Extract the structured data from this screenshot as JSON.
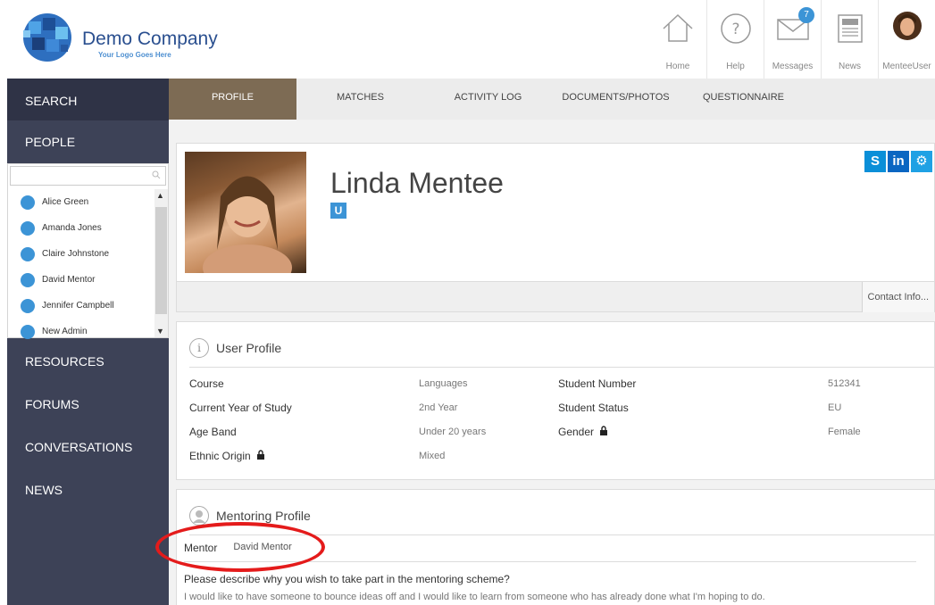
{
  "header": {
    "company_name": "Demo Company",
    "tagline": "Your Logo Goes Here",
    "nav": [
      {
        "label": "Home",
        "icon": "home-icon"
      },
      {
        "label": "Help",
        "icon": "help-icon"
      },
      {
        "label": "Messages",
        "icon": "mail-icon",
        "badge": "7"
      },
      {
        "label": "News",
        "icon": "news-icon"
      },
      {
        "label": "MenteeUser",
        "icon": "user-avatar"
      }
    ]
  },
  "sidebar": {
    "search": "SEARCH",
    "people": "PEOPLE",
    "people_search_placeholder": "",
    "people_list": [
      "Alice Green",
      "Amanda Jones",
      "Claire Johnstone",
      "David Mentor",
      "Jennifer Campbell",
      "New Admin"
    ],
    "items": [
      "RESOURCES",
      "FORUMS",
      "CONVERSATIONS",
      "NEWS"
    ]
  },
  "tabs": [
    {
      "label": "PROFILE",
      "active": true
    },
    {
      "label": "MATCHES"
    },
    {
      "label": "ACTIVITY LOG"
    },
    {
      "label": "DOCUMENTS/PHOTOS"
    },
    {
      "label": "QUESTIONNAIRE"
    }
  ],
  "profile": {
    "name": "Linda Mentee",
    "badge": "U",
    "social": [
      "S",
      "in",
      "⚙"
    ],
    "contact_info": "Contact Info..."
  },
  "user_profile": {
    "title": "User Profile",
    "fields": [
      {
        "label": "Course",
        "value": "Languages"
      },
      {
        "label": "Current Year of Study",
        "value": "2nd Year"
      },
      {
        "label": "Age Band",
        "value": "Under 20 years"
      },
      {
        "label": "Ethnic Origin",
        "value": "Mixed"
      },
      {
        "label": "Student Number",
        "value": "512341"
      },
      {
        "label": "Student Status",
        "value": "EU"
      },
      {
        "label": "Gender",
        "value": "Female"
      }
    ]
  },
  "mentoring_profile": {
    "title": "Mentoring Profile",
    "mentor_label": "Mentor",
    "mentor_value": "David Mentor",
    "question": "Please describe why you wish to take part in the mentoring scheme?",
    "answer": "I would like to have someone to bounce ideas off and I would like to learn from someone who has already done what I'm hoping to do."
  },
  "colors": {
    "sidebar": "#3d4257",
    "active_tab": "#7d6b54",
    "accent": "#3c94d6",
    "highlight": "#e41b1b"
  }
}
